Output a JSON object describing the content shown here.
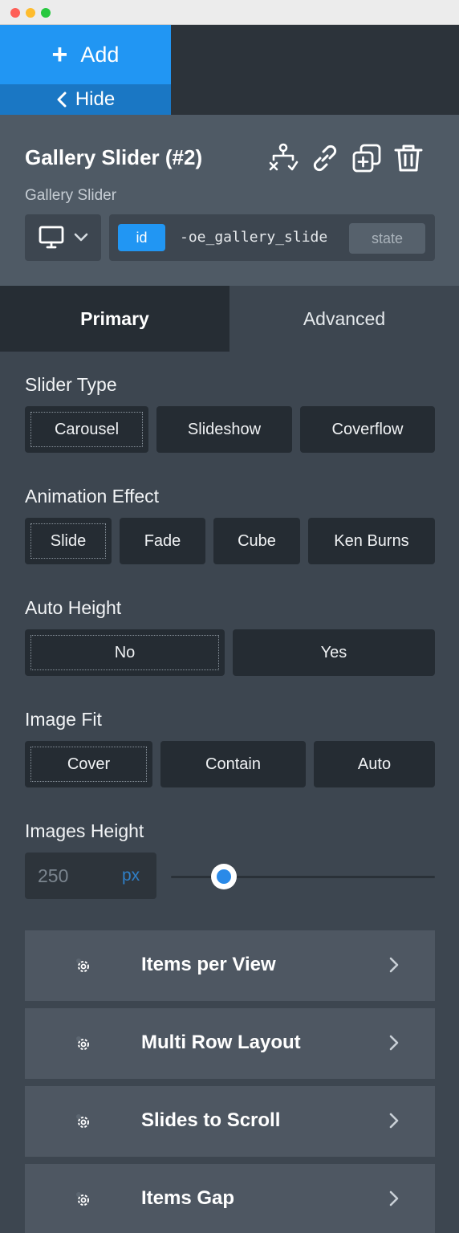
{
  "toolbar": {
    "add_label": "Add",
    "hide_label": "Hide"
  },
  "element": {
    "title": "Gallery Slider (#2)",
    "subtitle": "Gallery Slider",
    "selector_type": "id",
    "selector_value": "-oe_gallery_slide",
    "state_label": "state"
  },
  "tabs": {
    "primary": "Primary",
    "advanced": "Advanced"
  },
  "slider_type": {
    "label": "Slider Type",
    "options": [
      "Carousel",
      "Slideshow",
      "Coverflow"
    ],
    "selected": "Carousel"
  },
  "animation_effect": {
    "label": "Animation Effect",
    "options": [
      "Slide",
      "Fade",
      "Cube",
      "Ken Burns"
    ],
    "selected": "Slide"
  },
  "auto_height": {
    "label": "Auto Height",
    "options": [
      "No",
      "Yes"
    ],
    "selected": "No"
  },
  "image_fit": {
    "label": "Image Fit",
    "options": [
      "Cover",
      "Contain",
      "Auto"
    ],
    "selected": "Cover"
  },
  "images_height": {
    "label": "Images Height",
    "placeholder": "250",
    "unit": "px",
    "slider_fraction": 0.2
  },
  "sections": [
    {
      "label": "Items per View"
    },
    {
      "label": "Multi Row Layout"
    },
    {
      "label": "Slides to Scroll"
    },
    {
      "label": "Items Gap"
    }
  ],
  "colors": {
    "accent": "#2196f3",
    "panel": "#3d4650",
    "header": "#4f5a65",
    "button": "#252c33"
  }
}
